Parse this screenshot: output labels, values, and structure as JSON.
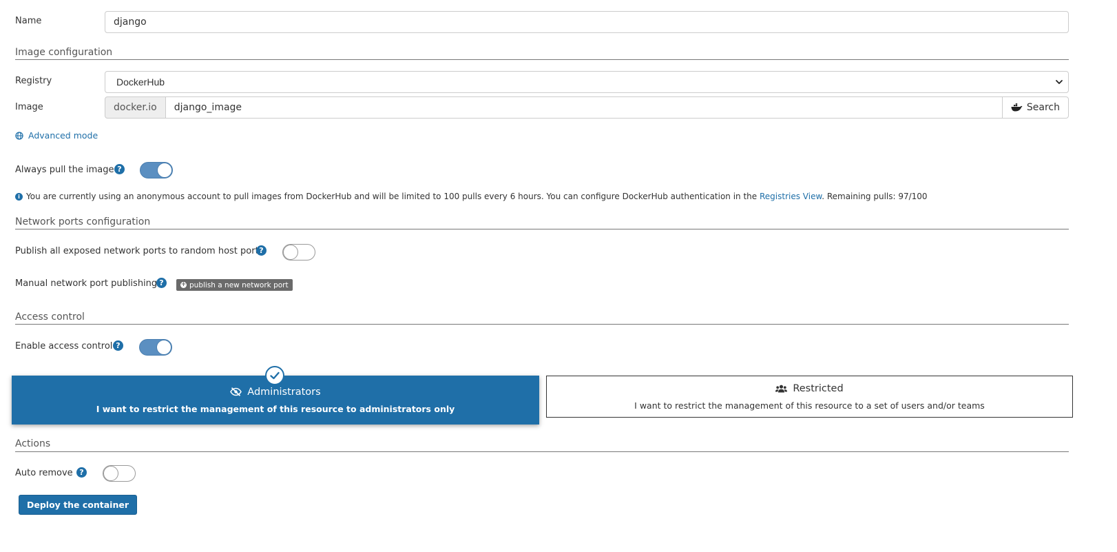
{
  "name_field": {
    "label": "Name",
    "value": "django"
  },
  "image_config": {
    "section_title": "Image configuration",
    "registry_label": "Registry",
    "registry_value": "DockerHub",
    "image_label": "Image",
    "image_prefix": "docker.io",
    "image_value": "django_image",
    "search_label": "Search",
    "advanced_mode_label": "Advanced mode",
    "always_pull_label": "Always pull the image",
    "always_pull_enabled": true,
    "info_text_1": "You are currently using an anonymous account to pull images from DockerHub and will be limited to 100 pulls every 6 hours. You can configure DockerHub authentication in the ",
    "info_link": "Registries View",
    "info_text_2": ". Remaining pulls: 97/100"
  },
  "network": {
    "section_title": "Network ports configuration",
    "publish_all_label": "Publish all exposed network ports to random host ports",
    "publish_all_enabled": false,
    "manual_label": "Manual network port publishing",
    "publish_button_label": "publish a new network port"
  },
  "access_control": {
    "section_title": "Access control",
    "enable_label": "Enable access control",
    "enabled": true,
    "options": [
      {
        "title": "Administrators",
        "description": "I want to restrict the management of this resource to administrators only",
        "selected": true
      },
      {
        "title": "Restricted",
        "description": "I want to restrict the management of this resource to a set of users and/or teams",
        "selected": false
      }
    ]
  },
  "actions": {
    "section_title": "Actions",
    "auto_remove_label": "Auto remove",
    "auto_remove_enabled": false,
    "deploy_button_label": "Deploy the container"
  },
  "colors": {
    "primary": "#1f6fa8",
    "toggle_on": "#5b8fc1",
    "muted_button": "#6a6a6a"
  },
  "icons": {
    "help": "question-circle-icon",
    "advanced": "globe-icon",
    "search": "docker-whale-icon",
    "info": "info-circle-icon",
    "administrators": "eye-slash-icon",
    "restricted": "users-icon",
    "selected": "check-circle-icon"
  }
}
